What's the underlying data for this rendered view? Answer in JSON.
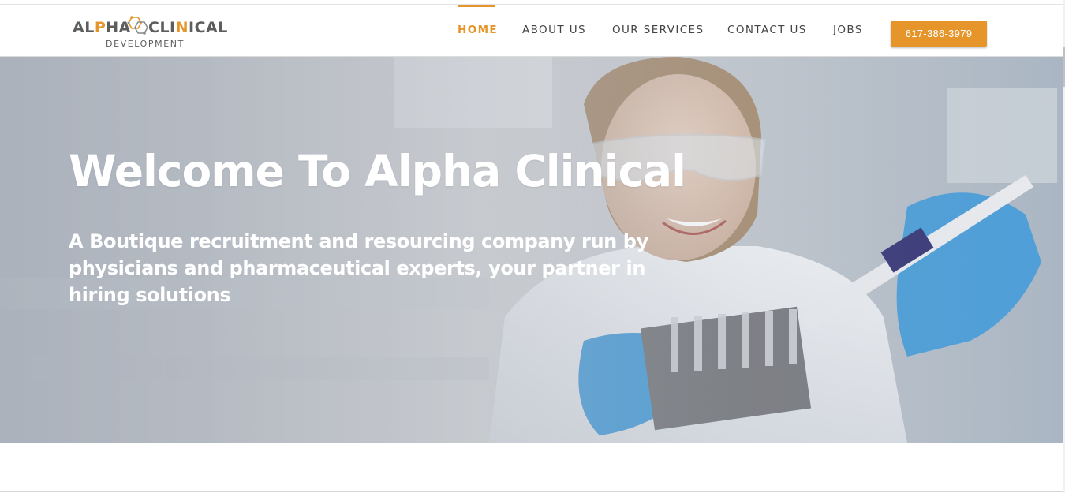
{
  "brand": {
    "name_left": "ALPHA",
    "name_right": "CLINICAL",
    "subtitle": "DEVELOPMENT",
    "accent_color": "#e6952a"
  },
  "nav": {
    "items": [
      {
        "label": "HOME",
        "active": true
      },
      {
        "label": "ABOUT US",
        "active": false
      },
      {
        "label": "OUR SERVICES",
        "active": false
      },
      {
        "label": "CONTACT US",
        "active": false
      },
      {
        "label": "JOBS",
        "active": false
      }
    ],
    "phone_button": "617-386-3979"
  },
  "hero": {
    "title": "Welcome To Alpha Clinical",
    "subtitle": "A Boutique recruitment and resourcing company run by physicians and pharmaceutical experts, your partner in hiring solutions",
    "image_icon": "lab-scientist-photo"
  }
}
